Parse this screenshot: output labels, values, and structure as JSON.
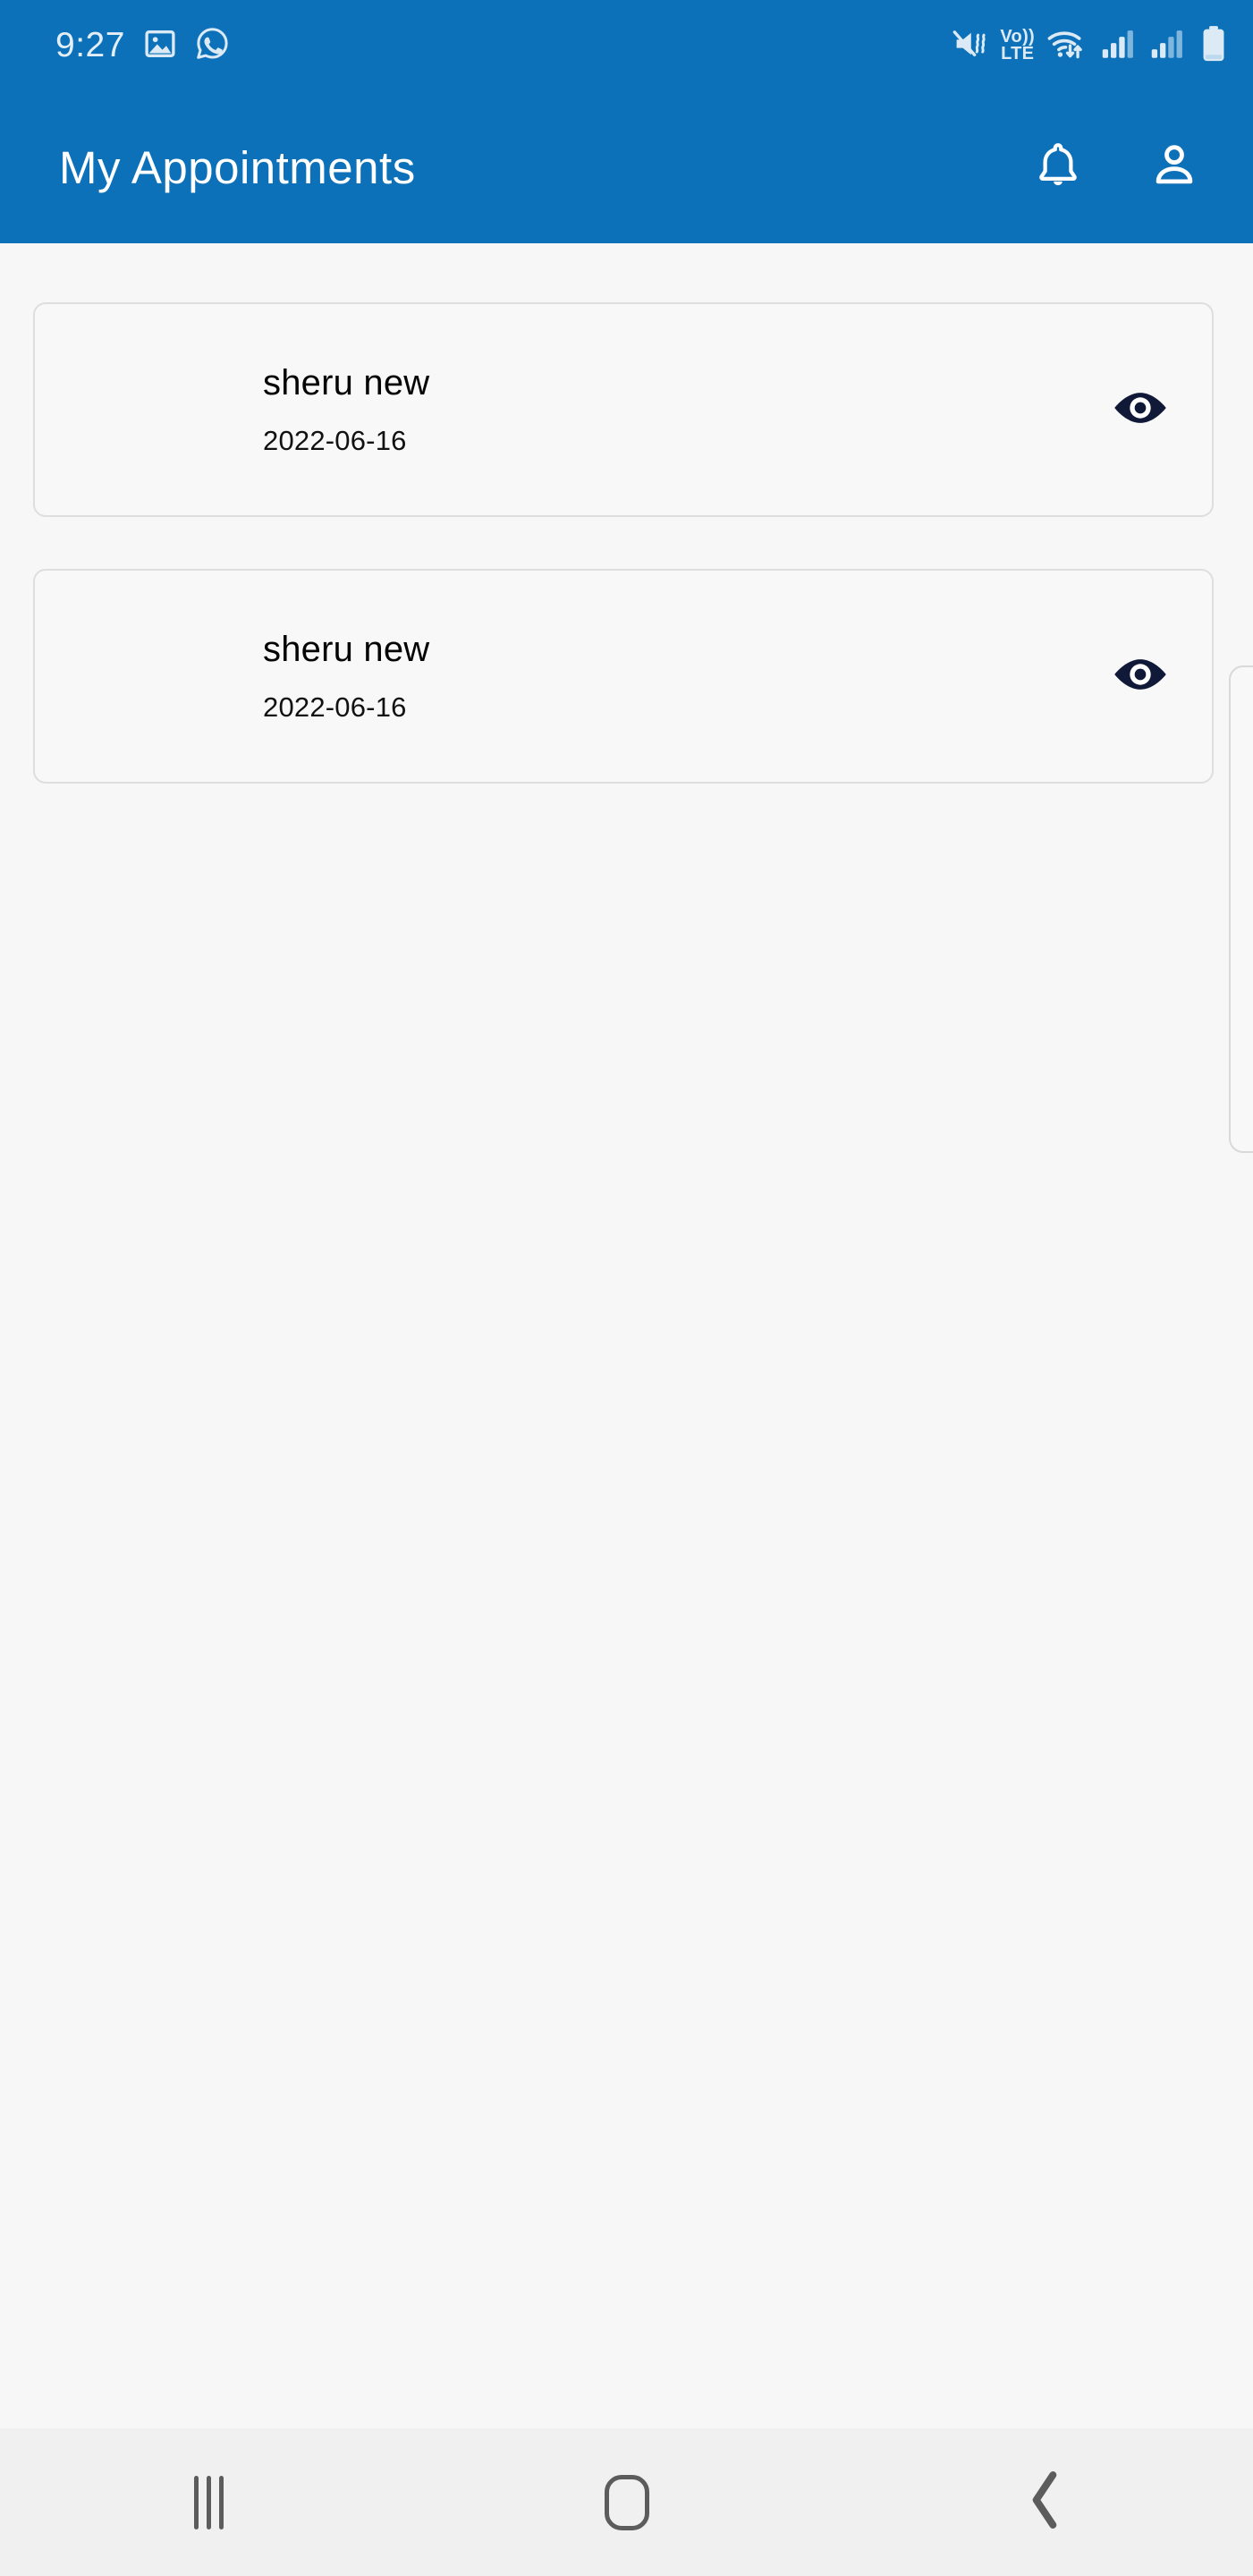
{
  "status_bar": {
    "clock": "9:27",
    "left_icons": [
      {
        "name": "gallery-icon"
      },
      {
        "name": "whatsapp-icon"
      }
    ],
    "right_icons": [
      {
        "name": "mute-vibrate-icon"
      },
      {
        "name": "volte-icon",
        "line1": "Vo))",
        "line2": "LTE"
      },
      {
        "name": "wifi-data-transfer-icon"
      },
      {
        "name": "signal-bars-sim1-icon"
      },
      {
        "name": "signal-bars-sim2-icon"
      },
      {
        "name": "battery-icon"
      }
    ],
    "background_color": "#0d71b9",
    "foreground_color": "#dceaf5"
  },
  "app_bar": {
    "title": "My Appointments",
    "background_color": "#0d71b9",
    "title_color": "#ffffff",
    "actions": [
      {
        "name": "notifications-button",
        "icon": "bell-icon"
      },
      {
        "name": "profile-button",
        "icon": "person-icon"
      }
    ]
  },
  "main": {
    "background_color": "#f7f7f7",
    "appointments": [
      {
        "title": "sheru new",
        "date": "2022-06-16",
        "action_icon": "eye-icon"
      },
      {
        "title": "sheru new",
        "date": "2022-06-16",
        "action_icon": "eye-icon"
      }
    ],
    "card": {
      "background_color": "#f8f8f8",
      "border_color": "#dedede",
      "title_color": "#050505",
      "date_color": "#111111",
      "eye_icon_color": "#101a38"
    }
  },
  "nav_bar": {
    "background_color": "#f0f0f0",
    "icon_color": "#5c5c5c",
    "buttons": [
      {
        "name": "recents-button",
        "icon": "recents-icon"
      },
      {
        "name": "home-button",
        "icon": "home-icon"
      },
      {
        "name": "back-button",
        "icon": "back-chevron-icon"
      }
    ]
  }
}
